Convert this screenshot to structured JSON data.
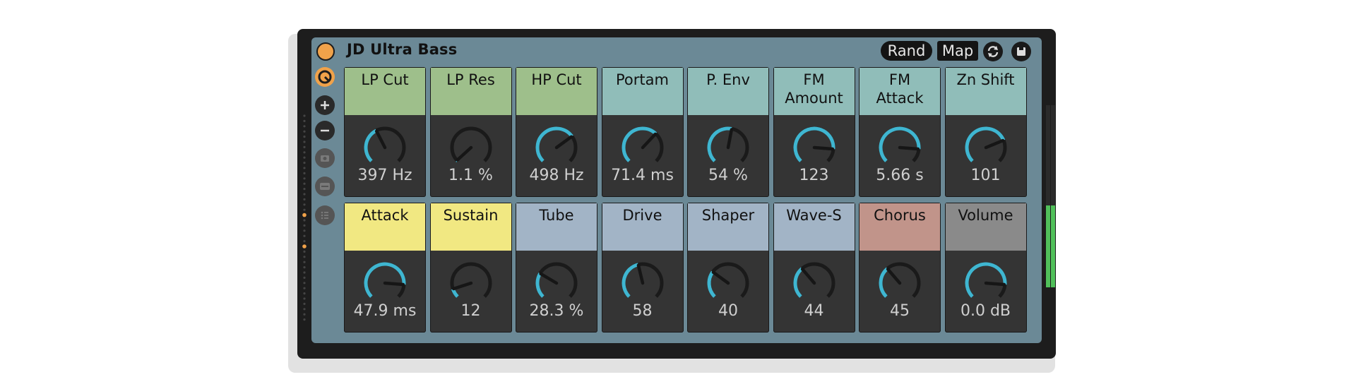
{
  "device": {
    "title": "JD Ultra Bass",
    "rand_label": "Rand",
    "map_label": "Map",
    "accent": "#f0a24a",
    "knob_arc_color": "#3fb6d1"
  },
  "sidebar": {
    "icons": [
      "quick-map-icon",
      "add-icon",
      "remove-icon",
      "snapshot-icon",
      "collapse-icon",
      "list-icon"
    ]
  },
  "grid": {
    "rows": [
      [
        {
          "label": "LP Cut",
          "value": "397 Hz",
          "color": "#9ebf8b",
          "level": 0.4
        },
        {
          "label": "LP Res",
          "value": "1.1 %",
          "color": "#9ebf8b",
          "level": 0.01
        },
        {
          "label": "HP Cut",
          "value": "498 Hz",
          "color": "#9ebf8b",
          "level": 0.7
        },
        {
          "label": "Portam",
          "value": "71.4 ms",
          "color": "#90bdb9",
          "level": 0.66
        },
        {
          "label": "P. Env",
          "value": "54 %",
          "color": "#90bdb9",
          "level": 0.54
        },
        {
          "label": "FM\nAmount",
          "value": "123",
          "color": "#90bdb9",
          "level": 0.85
        },
        {
          "label": "FM\nAttack",
          "value": "5.66 s",
          "color": "#90bdb9",
          "level": 0.85
        },
        {
          "label": "Zn Shift",
          "value": "101",
          "color": "#90bdb9",
          "level": 0.75
        }
      ],
      [
        {
          "label": "Attack",
          "value": "47.9 ms",
          "color": "#f1e882",
          "level": 0.85
        },
        {
          "label": "Sustain",
          "value": "12",
          "color": "#f1e882",
          "level": 0.1
        },
        {
          "label": "Tube",
          "value": "28.3 %",
          "color": "#a2b4c6",
          "level": 0.28
        },
        {
          "label": "Drive",
          "value": "58",
          "color": "#a2b4c6",
          "level": 0.45
        },
        {
          "label": "Shaper",
          "value": "40",
          "color": "#a2b4c6",
          "level": 0.3
        },
        {
          "label": "Wave-S",
          "value": "44",
          "color": "#a2b4c6",
          "level": 0.35
        },
        {
          "label": "Chorus",
          "value": "45",
          "color": "#c1948a",
          "level": 0.35
        },
        {
          "label": "Volume",
          "value": "0.0 dB",
          "color": "#8a8a8a",
          "level": 0.85
        }
      ]
    ]
  },
  "meters": {
    "left_level": 0.45,
    "right_level": 0.45
  }
}
